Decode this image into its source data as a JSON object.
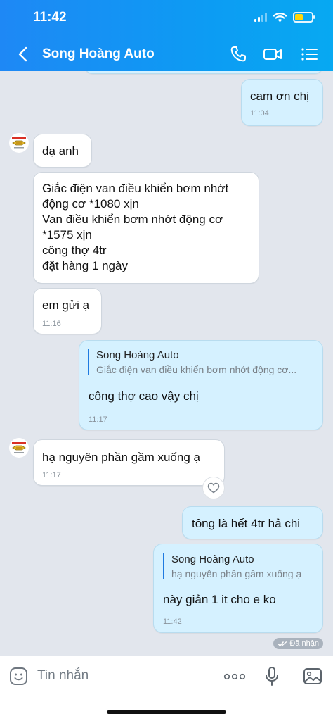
{
  "status": {
    "time": "11:42"
  },
  "header": {
    "title": "Song Hoàng Auto"
  },
  "messages": {
    "m1": {
      "text": "cam ơn chị",
      "time": "11:04"
    },
    "m2": {
      "text": "dạ anh"
    },
    "m3": {
      "line1": "Giắc điện van điều khiển bơm nhớt",
      "line2": "động cơ *1080 xịn",
      "line3": "Van điều khiển bơm nhớt động cơ",
      "line4": "*1575 xịn",
      "line5": "công thợ 4tr",
      "line6": "đặt hàng 1 ngày"
    },
    "m4": {
      "text": "em gửi ạ",
      "time": "11:16"
    },
    "m5": {
      "quote_name": "Song Hoàng Auto",
      "quote_text": "Giắc điện van điều khiển bơm nhớt động cơ...",
      "text": "công thợ cao vậy chị",
      "time": "11:17"
    },
    "m6": {
      "text": "hạ nguyên phần gầm xuống ạ",
      "time": "11:17"
    },
    "m7": {
      "text": "tông là hết 4tr hả chi"
    },
    "m8": {
      "quote_name": "Song Hoàng Auto",
      "quote_text": "hạ nguyên phần gầm xuống ạ",
      "text": "này giản 1 it cho e ko",
      "time": "11:42"
    }
  },
  "seen_label": "Đã nhận",
  "composer": {
    "placeholder": "Tin nhắn"
  },
  "colors": {
    "header_start": "#1e88f5",
    "header_end": "#07a9f2",
    "outgoing_bubble": "#d5f1ff",
    "incoming_bubble": "#ffffff",
    "quote_bar": "#1f7ae0"
  },
  "icons": [
    "back-arrow-icon",
    "phone-icon",
    "video-call-icon",
    "menu-list-icon",
    "sticker-icon",
    "more-icon",
    "microphone-icon",
    "image-icon",
    "heart-icon",
    "double-check-icon"
  ]
}
